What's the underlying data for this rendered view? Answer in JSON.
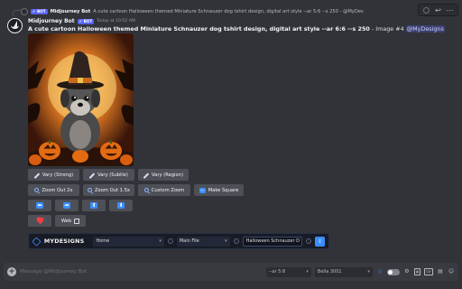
{
  "reply": {
    "tag": "✔ BOT",
    "author": "Midjourney Bot",
    "text": "A cute cartoon Halloween themed Miniature Schnauzer dog tshirt design, digital art style --ar 5:6 --s 250 - @MyDes"
  },
  "message": {
    "author": "Midjourney Bot",
    "tag": "✔ BOT",
    "timestamp": "Today at 10:52 AM",
    "prompt": "A cute cartoon Halloween themed Miniature Schnauzer dog tshirt design, digital art style --ar 6:6 --s 250",
    "suffix": " - Image #4 ",
    "mention": "@MyDesigns"
  },
  "buttons": {
    "row1": [
      "Vary (Strong)",
      "Vary (Subtle)",
      "Vary (Region)"
    ],
    "row2": [
      "Zoom Out 2x",
      "Zoom Out 1.5x",
      "Custom Zoom",
      "Make Square"
    ],
    "row3_icons": [
      "arrow-left-icon",
      "arrow-right-icon",
      "arrow-up-icon",
      "arrow-down-icon"
    ],
    "row4": {
      "web": "Web"
    }
  },
  "mydesigns": {
    "brand_prefix": "MY",
    "brand_suffix": "DESIGNS",
    "workspace": "Home",
    "file": "Main File",
    "title_value": "Halloween Schnauzer D"
  },
  "composer": {
    "placeholder": "Message @Midjourney Bot",
    "param": "--ar 5:6",
    "model": "Bella 3001"
  },
  "colors": {
    "accent": "#3a8dff",
    "brand_blurple": "#5865f2",
    "background": "#313338"
  }
}
